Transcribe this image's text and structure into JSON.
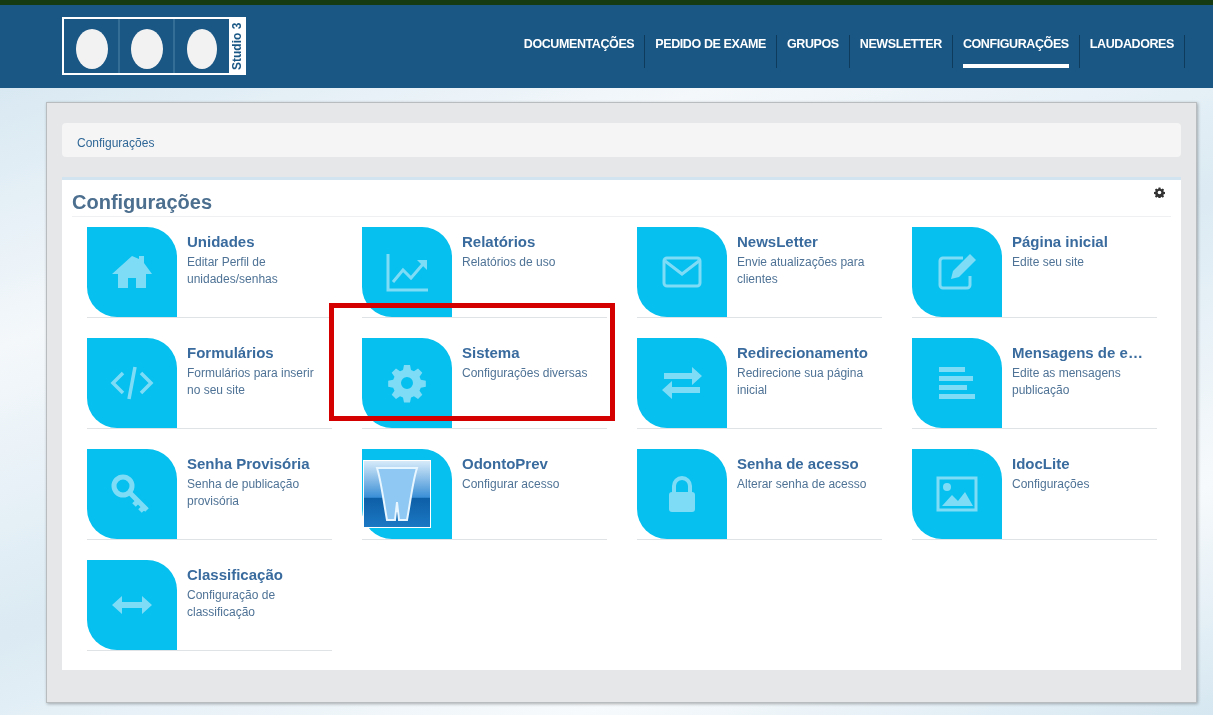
{
  "logo": {
    "text": "Studio 3"
  },
  "nav": [
    {
      "label": "DOCUMENTAÇÕES",
      "selected": false
    },
    {
      "label": "PEDIDO DE EXAME",
      "selected": false
    },
    {
      "label": "GRUPOS",
      "selected": false
    },
    {
      "label": "NEWSLETTER",
      "selected": false
    },
    {
      "label": "CONFIGURAÇÕES",
      "selected": true
    },
    {
      "label": "LAUDADORES",
      "selected": false
    }
  ],
  "breadcrumb": "Configurações",
  "section_title": "Configurações",
  "tiles": [
    {
      "kind": "icon",
      "title": "Unidades",
      "description": "Editar Perfil de unidades/senhas",
      "highlighted": false
    },
    {
      "kind": "icon",
      "title": "Relatórios",
      "description": "Relatórios de uso",
      "highlighted": false
    },
    {
      "kind": "icon",
      "title": "NewsLetter",
      "description": "Envie atualizações para clientes",
      "highlighted": false
    },
    {
      "kind": "icon",
      "title": "Página inicial",
      "description": "Edite seu site",
      "highlighted": false
    },
    {
      "kind": "icon",
      "title": "Formulários",
      "description": "Formulários para inserir no seu site",
      "highlighted": false
    },
    {
      "kind": "icon",
      "title": "Sistema",
      "description": "Configurações diversas",
      "highlighted": true
    },
    {
      "kind": "icon",
      "title": "Redirecionamento",
      "description": "Redirecione sua página inicial",
      "highlighted": false
    },
    {
      "kind": "icon",
      "title": "Mensagens de e…",
      "description": "Edite as mensagens publicação",
      "highlighted": false
    },
    {
      "kind": "icon",
      "title": "Senha Provisória",
      "description": "Senha de publicação provisória",
      "highlighted": false
    },
    {
      "kind": "image",
      "title": "OdontoPrev",
      "description": "Configurar acesso",
      "highlighted": false
    },
    {
      "kind": "icon",
      "title": "Senha de acesso",
      "description": "Alterar senha de acesso",
      "highlighted": false
    },
    {
      "kind": "icon",
      "title": "IdocLite",
      "description": "Configurações",
      "highlighted": false
    },
    {
      "kind": "icon",
      "title": "Classificação",
      "description": "Configuração de classificação",
      "highlighted": false
    }
  ]
}
